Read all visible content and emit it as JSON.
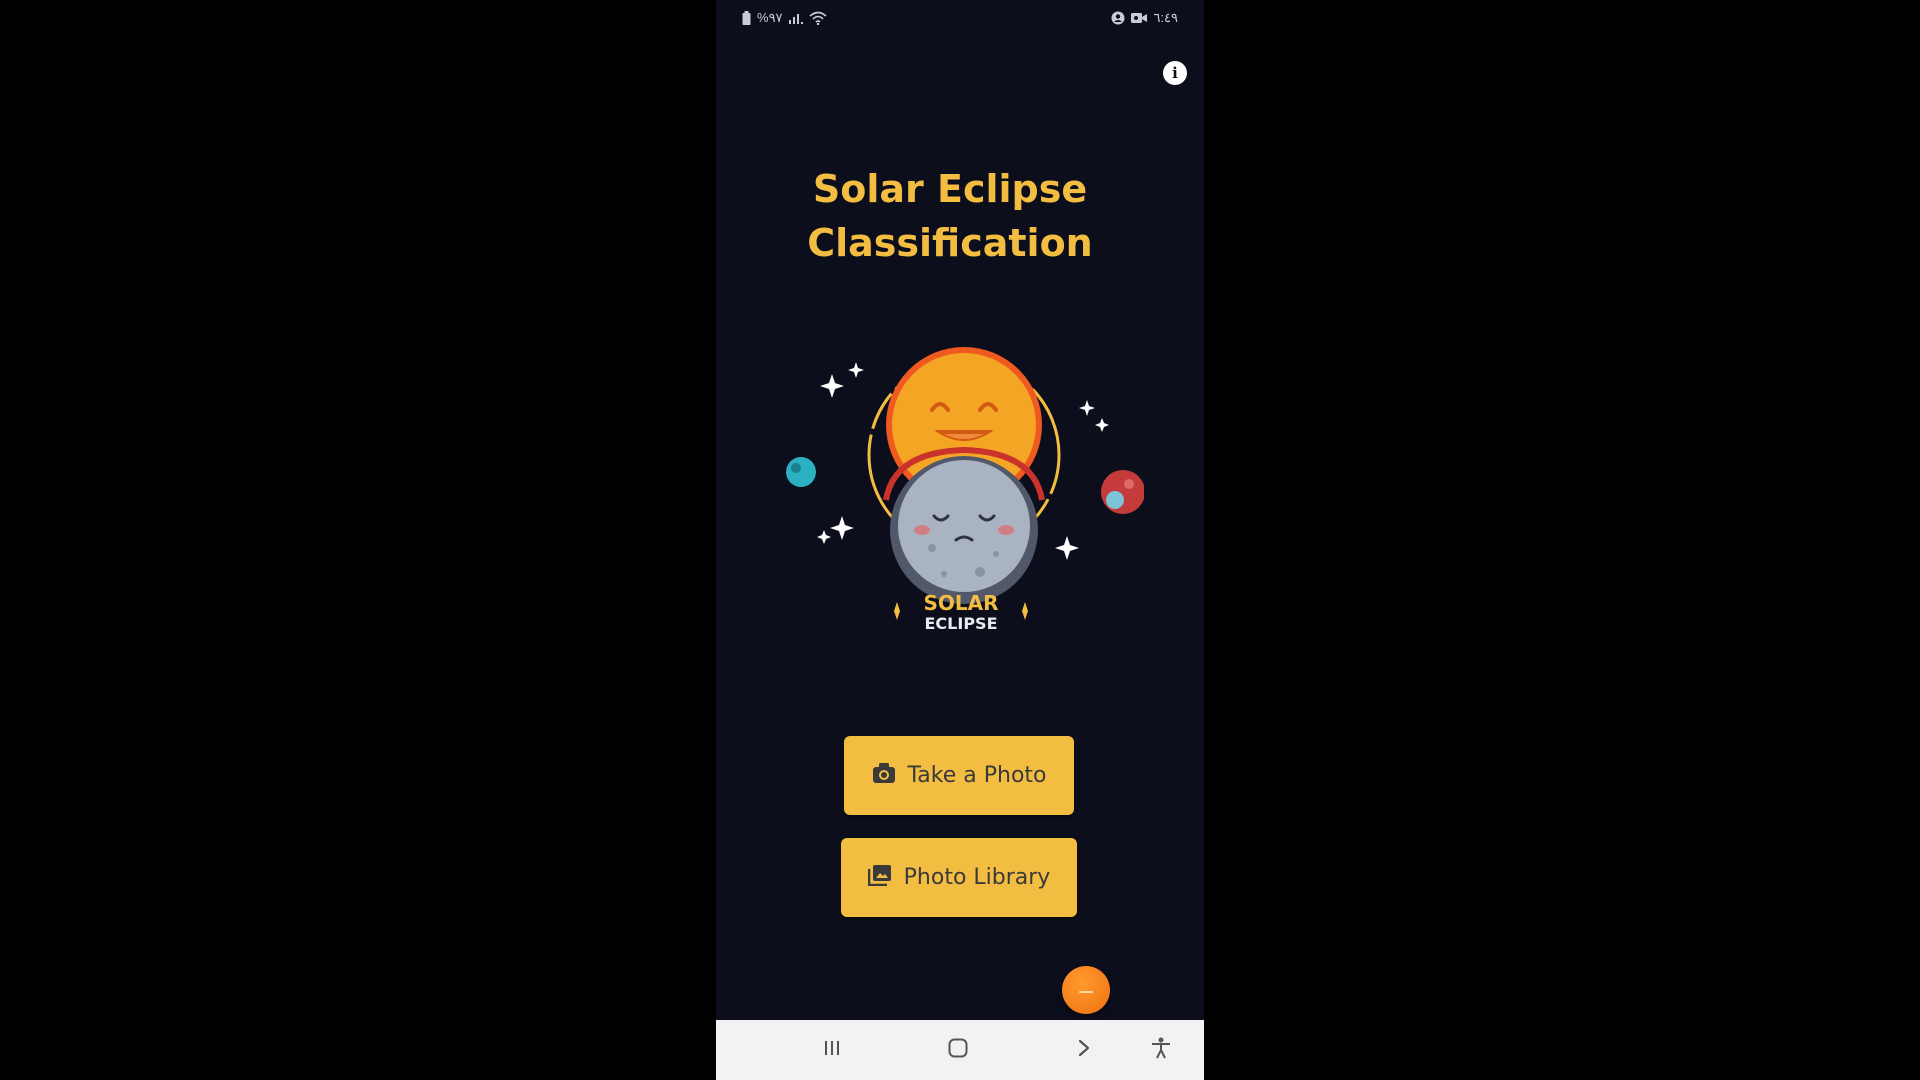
{
  "status_bar": {
    "left_text": "%٩٧",
    "time": "٦:٤٩",
    "icons": [
      "battery-icon",
      "signal-icon",
      "wifi-icon",
      "account-icon",
      "video-record-icon"
    ]
  },
  "header": {
    "info_icon": "info-icon",
    "info_glyph": "i"
  },
  "main": {
    "title_line1": "Solar Eclipse",
    "title_line2": "Classification",
    "illustration": {
      "badge_line1": "SOLAR",
      "badge_line2": "ECLIPSE"
    },
    "take_photo_button": {
      "label": "Take a Photo",
      "icon": "camera-icon"
    },
    "photo_library_button": {
      "label": "Photo Library",
      "icon": "image-icon"
    }
  },
  "nav_bar": {
    "items": [
      "recent-apps-icon",
      "home-icon",
      "back-icon",
      "accessibility-icon"
    ]
  },
  "colors": {
    "background": "#0c0e1b",
    "accent": "#f3bd42",
    "fab": "#f07010",
    "nav_bar": "#f2f2f4"
  }
}
